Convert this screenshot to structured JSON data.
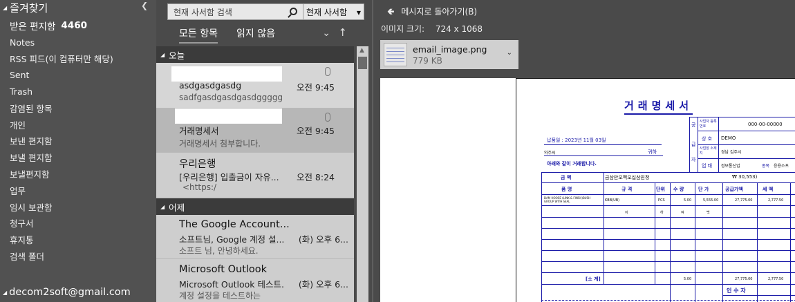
{
  "folders": {
    "favorites_label": "즐겨찾기",
    "inbox": {
      "label": "받은 편지함",
      "count": "4460"
    },
    "items": [
      "Notes",
      "RSS 피드(이 컴퓨터만 해당)",
      "Sent",
      "Trash",
      "감염된 항목",
      "개인",
      "보낸 편지함",
      "보낼 편지함",
      "보낼편지함",
      "업무",
      "임시 보관함",
      "청구서",
      "휴지통",
      "검색 폴더"
    ],
    "account": "decom2soft@gmail.com"
  },
  "search": {
    "placeholder": "현재 사서함 검색",
    "scope": "현재 사서함"
  },
  "filters": {
    "all": "모든 항목",
    "unread": "읽지 않음"
  },
  "groups": {
    "today": "오늘",
    "yesterday": "어제"
  },
  "messages": [
    {
      "subject": "asdgasdgasdg",
      "preview": "sadfgasdgasdgasdgggggggg",
      "time": "오전 9:45"
    },
    {
      "subject": "거래명세서",
      "preview": "거래명세서 첨부합니다.",
      "time": "오전 9:45"
    },
    {
      "sender": "우리은행",
      "subject": "[우리은행] 입출금이 자유...",
      "preview": "<https:/",
      "time": "오전 8:24"
    },
    {
      "sender": "The Google Account...",
      "subject": "소프트님, Google 계정 설...",
      "preview": "소프트 님, 안녕하세요.",
      "time": "(화) 오후 6..."
    },
    {
      "sender": "Microsoft Outlook",
      "subject": "Microsoft Outlook 테스트...",
      "preview": "계정 설정을 테스트하는",
      "time": "(화) 오후 6..."
    }
  ],
  "preview": {
    "back": "메시지로 돌아가기(B)",
    "image_size_label": "이미지 크기:",
    "image_size": "724 x 1068",
    "attachment": {
      "name": "email_image.png",
      "size": "779 KB"
    }
  },
  "document": {
    "title": "거래명세서",
    "date": "납품일 : 2023년 11월 03일",
    "recipient_suffix": "귀하",
    "recipient_prefix": "와주씨",
    "notice": "아래와 같이 거래합니다.",
    "supplier_fields": {
      "reg_no_label": "사업자 등록번호",
      "reg_no": "000-00-00000",
      "name_label": "상 호",
      "name": "DEMO",
      "address_label": "사업장 소재지",
      "address": "경남 김주시",
      "type_label": "업 태",
      "type": "정보통신업",
      "item_label": "종목",
      "item": "응용소프"
    },
    "supplier_side": [
      "공",
      "급",
      "자"
    ],
    "amount_label": "금 액",
    "amount_hangul": "금삼만오백오십삼원정",
    "amount": "₩ 30,553)",
    "headers": [
      "품 명",
      "규 격",
      "단위",
      "수 량",
      "단 가",
      "공급가액",
      "세 액"
    ],
    "row1": {
      "name": "DAM HOOSE (LINK & FINSH)BUSH GROUP WITH SEAL",
      "spec": "KBB(UB)",
      "unit": "PCS",
      "qty": "5.00",
      "price": "5,555.00",
      "supply": "27,775.00",
      "tax": "2,777.50"
    },
    "row2": {
      "spec": "이",
      "unit": "하",
      "qty": "여",
      "price": "백"
    },
    "subtotal_label": "[소   계]",
    "subtotal_qty": "5.00",
    "subtotal_supply": "27,775.00",
    "subtotal_tax": "2,777.50",
    "receiver_label": "인 수 자"
  }
}
